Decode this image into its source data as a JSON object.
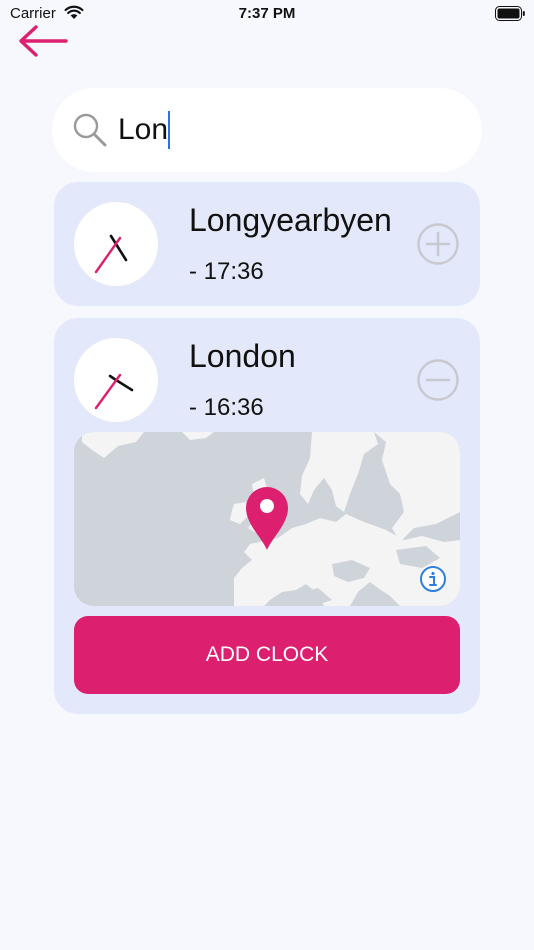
{
  "status_bar": {
    "carrier": "Carrier",
    "time": "7:37 PM"
  },
  "search": {
    "value": "Lon"
  },
  "results": [
    {
      "city": "Longyearbyen",
      "time": "- 17:36",
      "action": "plus-circle-icon"
    },
    {
      "city": "London",
      "time": "- 16:36",
      "action": "minus-circle-icon"
    }
  ],
  "add_clock": {
    "label": "ADD CLOCK"
  },
  "colors": {
    "accent": "#dc1f6e",
    "card": "#e3e9fa",
    "background": "#f7f8fd",
    "info": "#2f7fe0"
  }
}
